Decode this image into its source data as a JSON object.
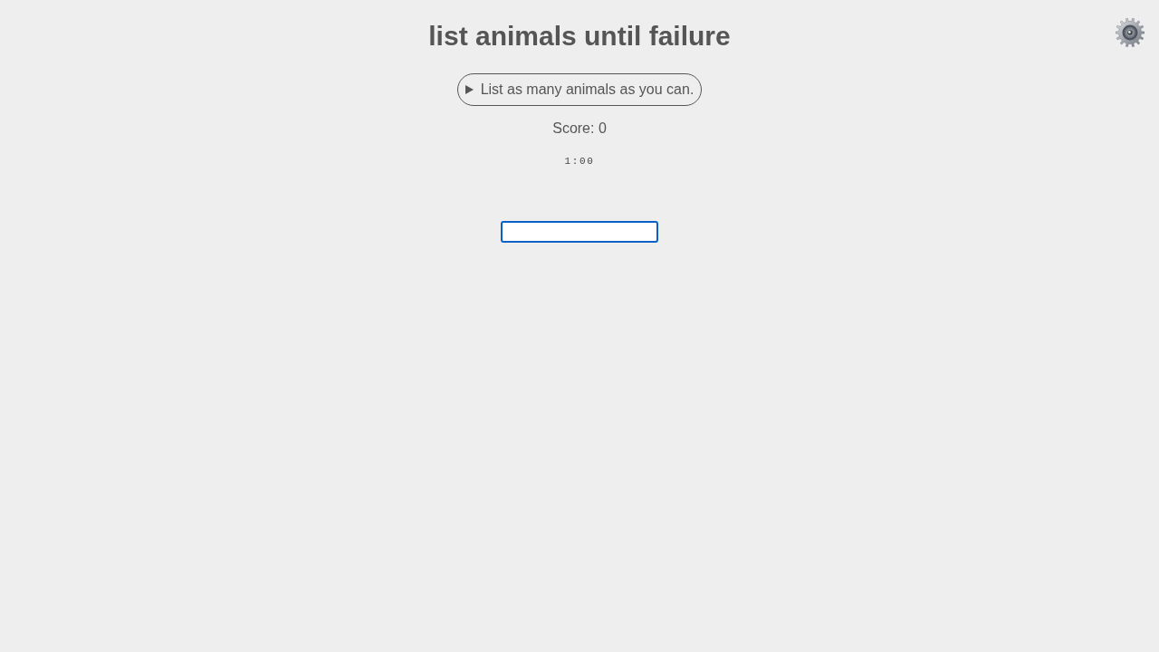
{
  "title": "list animals until failure",
  "instructions": {
    "label": "List as many animals as you can.",
    "expanded": false
  },
  "score": "Score: 0",
  "timer": "1:00",
  "answer_field": {
    "focused": true
  }
}
